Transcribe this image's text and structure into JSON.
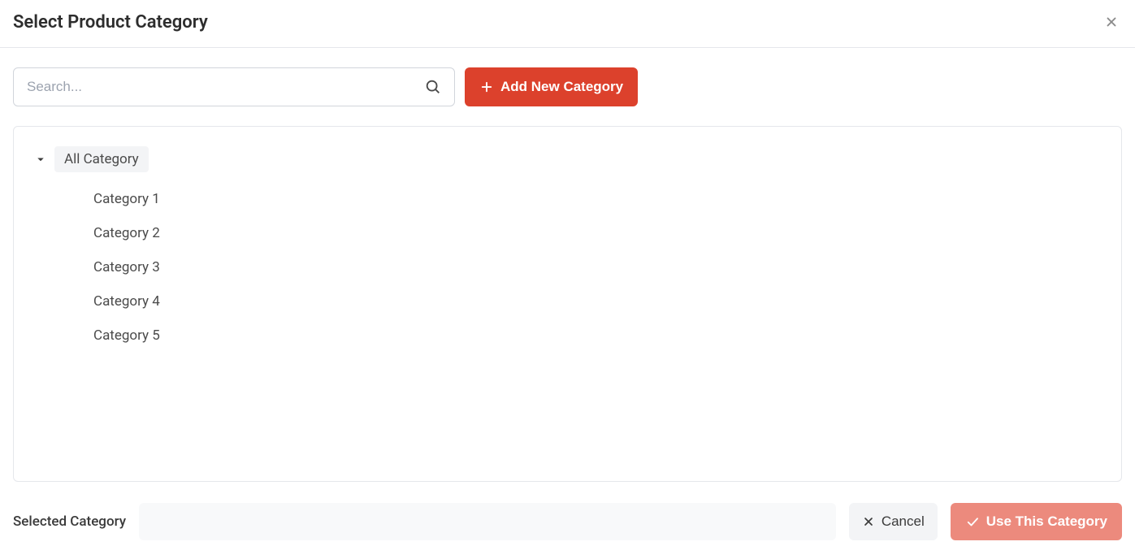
{
  "header": {
    "title": "Select Product Category"
  },
  "search": {
    "placeholder": "Search..."
  },
  "buttons": {
    "add_category": "Add New Category",
    "cancel": "Cancel",
    "use_category": "Use This Category"
  },
  "tree": {
    "root_label": "All Category",
    "items": [
      "Category 1",
      "Category 2",
      "Category 3",
      "Category 4",
      "Category 5"
    ]
  },
  "footer": {
    "selected_label": "Selected Category",
    "selected_value": ""
  }
}
